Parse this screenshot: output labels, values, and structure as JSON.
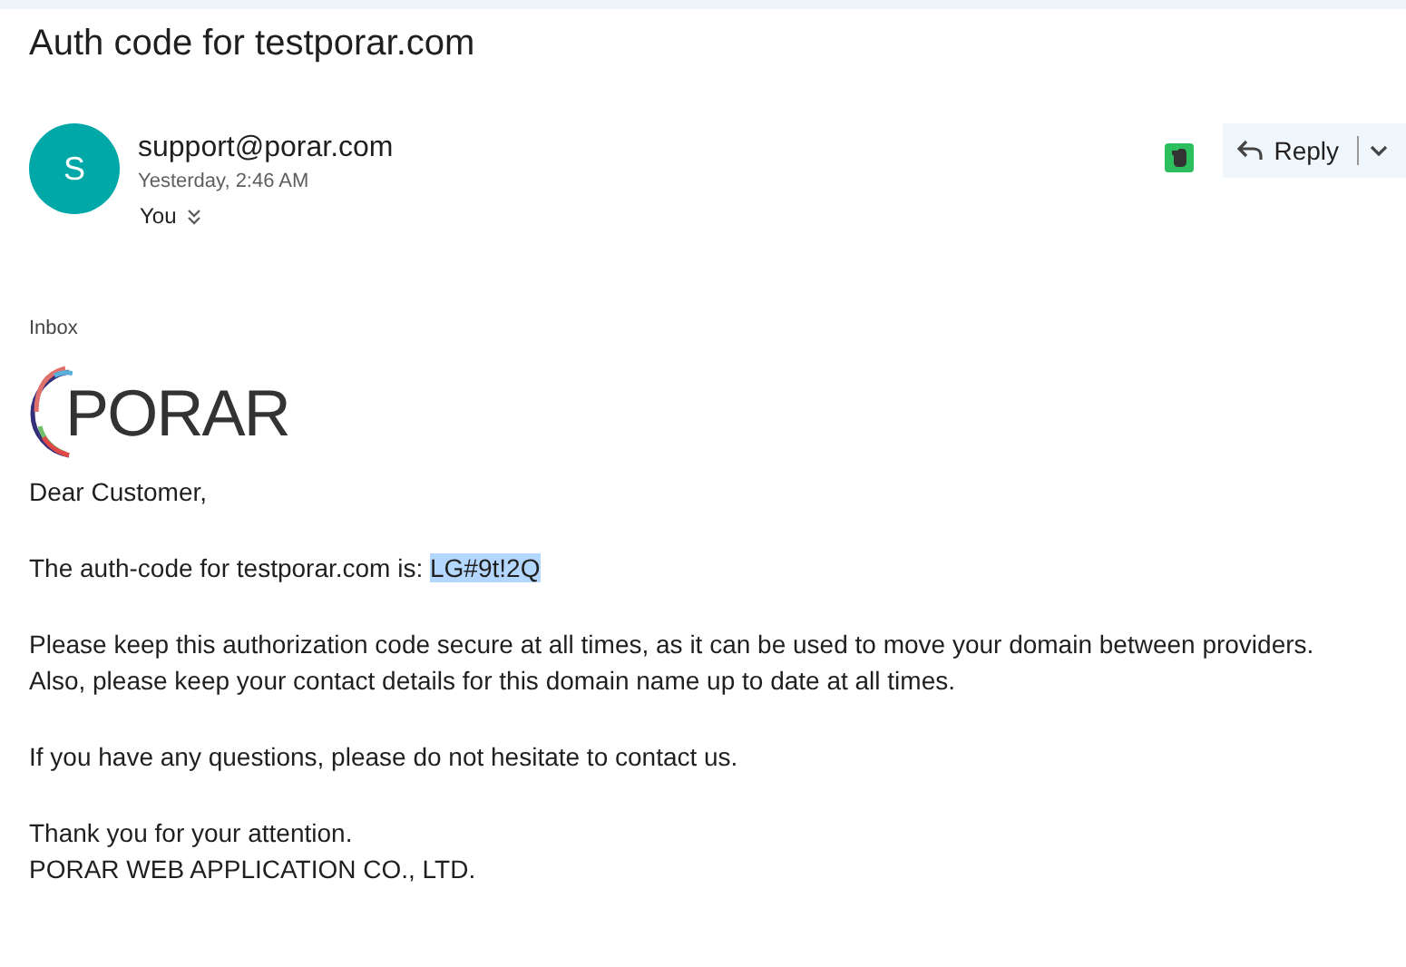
{
  "subject": "Auth code for testporar.com",
  "sender": {
    "initial": "S",
    "address": "support@porar.com",
    "time": "Yesterday, 2:46 AM",
    "to": "You"
  },
  "reply_button": {
    "label": "Reply"
  },
  "folder": "Inbox",
  "logo": {
    "text": "PORAR"
  },
  "body": {
    "greeting": "Dear Customer,",
    "code_line": {
      "prefix": "The auth-code for testporar.com is: ",
      "code": "LG#9t!2Q",
      "highlighted": true
    },
    "paragraphs": [
      [
        "Please keep this authorization code secure at all times, as it can be used to move your domain between providers.",
        "Also, please keep your contact details for this domain name up to date at all times."
      ],
      [
        "If you have any questions, please do not hesitate to contact us."
      ],
      [
        "Thank you for your attention.",
        "PORAR WEB APPLICATION CO., LTD."
      ]
    ]
  }
}
